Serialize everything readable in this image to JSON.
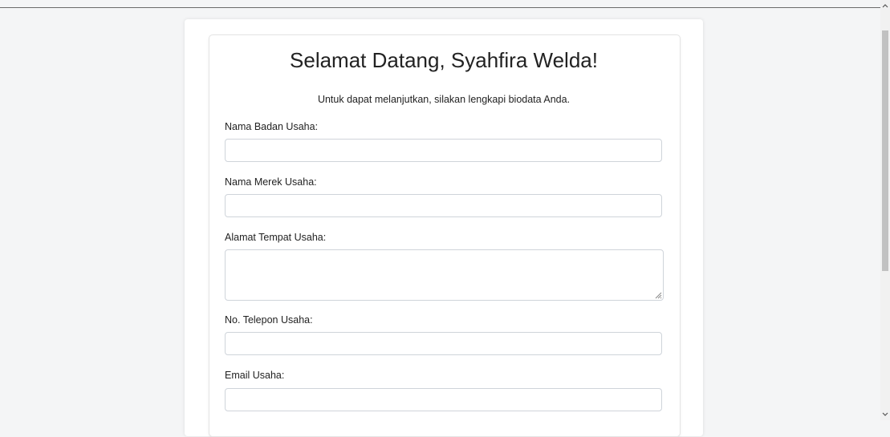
{
  "header": {
    "title": "Selamat Datang, Syahfira Welda!",
    "subtitle": "Untuk dapat melanjutkan, silakan lengkapi biodata Anda."
  },
  "form": {
    "fields": [
      {
        "label": "Nama Badan Usaha:",
        "value": "",
        "type": "text"
      },
      {
        "label": "Nama Merek Usaha:",
        "value": "",
        "type": "text"
      },
      {
        "label": "Alamat Tempat Usaha:",
        "value": "",
        "type": "textarea"
      },
      {
        "label": "No. Telepon Usaha:",
        "value": "",
        "type": "text"
      },
      {
        "label": "Email Usaha:",
        "value": "",
        "type": "text"
      }
    ]
  },
  "scrollbar": {
    "up_icon": "chevron-up-icon",
    "down_icon": "chevron-down-icon"
  }
}
